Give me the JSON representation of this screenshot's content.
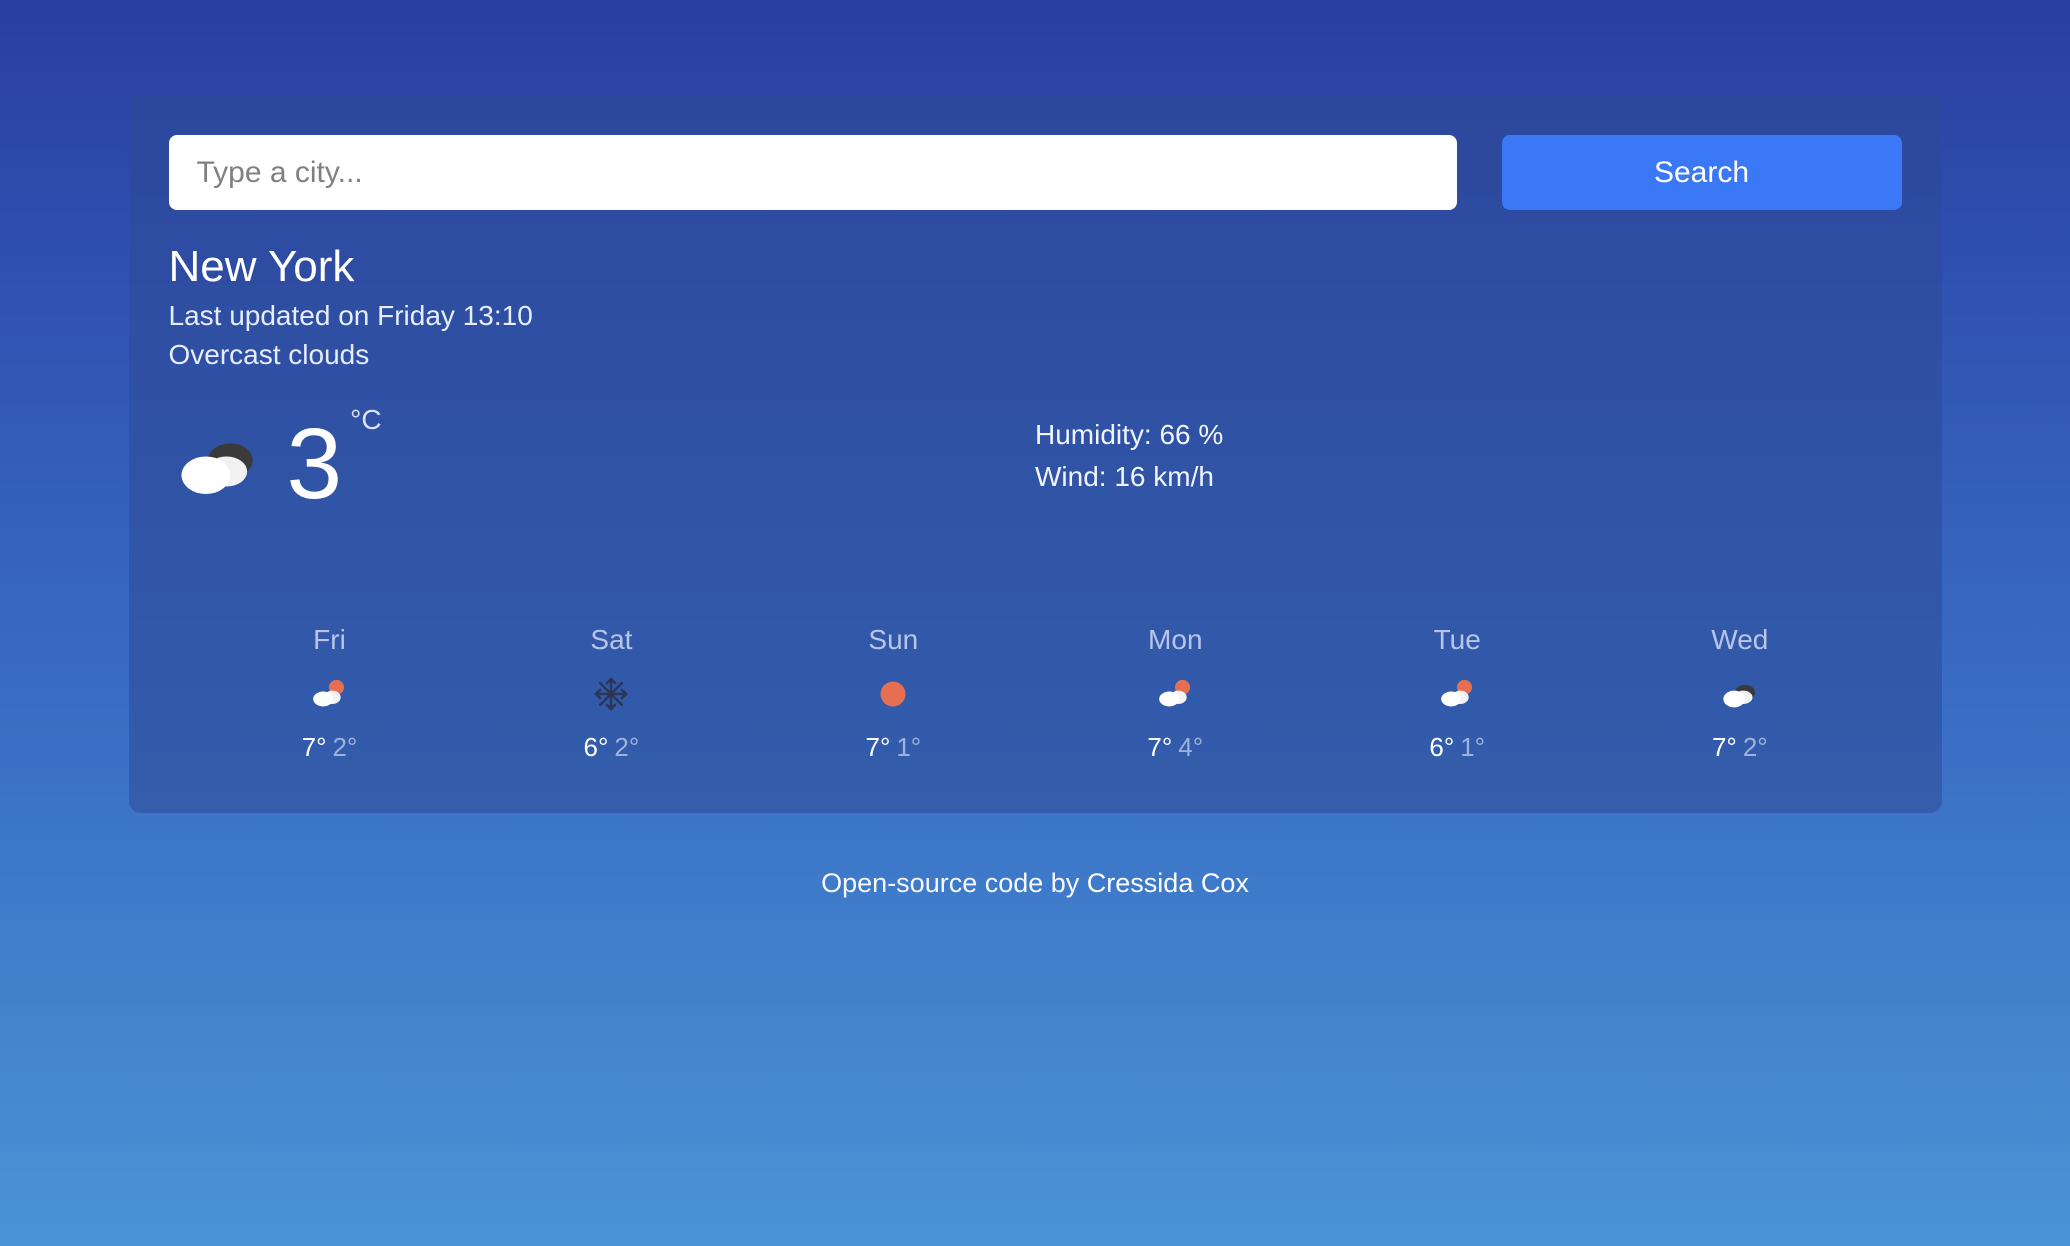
{
  "search": {
    "placeholder": "Type a city...",
    "button_label": "Search"
  },
  "current": {
    "city": "New York",
    "updated_line": "Last updated on Friday 13:10",
    "description": "Overcast clouds",
    "temperature": "3",
    "temperature_unit": "°C",
    "humidity_line": "Humidity: 66 %",
    "wind_line": "Wind: 16 km/h",
    "icon": "cloud-dark"
  },
  "forecast": [
    {
      "day": "Fri",
      "icon": "cloud-sun",
      "high": "7°",
      "low": "2°"
    },
    {
      "day": "Sat",
      "icon": "snow",
      "high": "6°",
      "low": "2°"
    },
    {
      "day": "Sun",
      "icon": "sun",
      "high": "7°",
      "low": "1°"
    },
    {
      "day": "Mon",
      "icon": "cloud-sun",
      "high": "7°",
      "low": "4°"
    },
    {
      "day": "Tue",
      "icon": "cloud-sun",
      "high": "6°",
      "low": "1°"
    },
    {
      "day": "Wed",
      "icon": "cloud-dark",
      "high": "7°",
      "low": "2°"
    }
  ],
  "footer": {
    "prefix": "Open-source code by ",
    "author": "Cressida Cox"
  }
}
